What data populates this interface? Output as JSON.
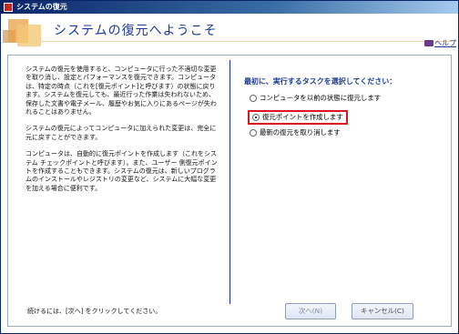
{
  "window": {
    "title": "システムの復元"
  },
  "header": {
    "title": "システムの復元へようこそ",
    "help": "ヘルプ"
  },
  "left": {
    "paragraphs": [
      "システムの復元を使用すると、コンピュータに行った不適切な変更を取り消し、設定とパフォーマンスを復元できます。コンピュータは、特定の時点（これを[復元ポイント]と呼びます）の状態に戻ります。システムを復元しても、最近行った作業は失われないため、保存した文書や電子メール、履歴やお気に入りにあるページが失われることはありません。",
      "システムの復元によってコンピュータに加えられた変更は、完全に元に戻すことができます。",
      "コンピュータは、自動的に復元ポイントを作成します（これをシステム チェックポイントと呼びます）。また、ユーザー 側復元ポイントを作成することもできます。システムの復元は、新しいプログラムのインストールやレジストリの変更など、システムに大幅な変更を加える場合に便利です。"
    ],
    "footer": "続けるには、[次へ] をクリックしてください。"
  },
  "right": {
    "heading": "最初に、実行するタスクを選択してください：",
    "options": [
      {
        "label": "コンピュータを以前の状態に復元します",
        "selected": false
      },
      {
        "label": "復元ポイントを作成します",
        "selected": true
      },
      {
        "label": "最新の復元を取り消します",
        "selected": false
      }
    ]
  },
  "buttons": {
    "next": "次へ(N)",
    "cancel": "キャンセル(C)"
  },
  "colors": {
    "accent": "#1a3a9a",
    "highlight": "#e0141e"
  }
}
